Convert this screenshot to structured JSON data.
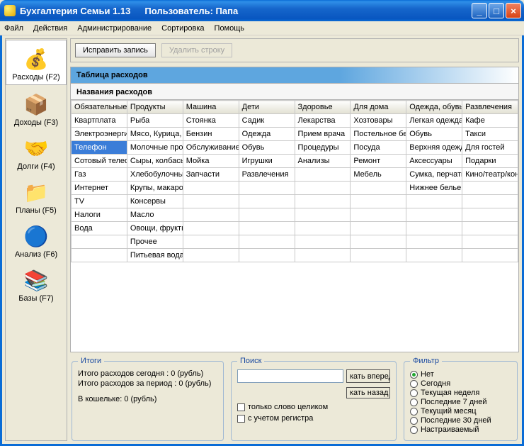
{
  "window": {
    "title": "Бухгалтерия Семьи 1.13",
    "user_label": "Пользователь: Папа"
  },
  "menu": [
    "Файл",
    "Действия",
    "Администрирование",
    "Сортировка",
    "Помощь"
  ],
  "sidebar": [
    {
      "label": "Расходы (F2)",
      "icon": "💰",
      "active": true
    },
    {
      "label": "Доходы (F3)",
      "icon": "📦",
      "active": false
    },
    {
      "label": "Долги (F4)",
      "icon": "🤝",
      "active": false
    },
    {
      "label": "Планы (F5)",
      "icon": "📁",
      "active": false
    },
    {
      "label": "Анализ (F6)",
      "icon": "🔵",
      "active": false
    },
    {
      "label": "Базы (F7)",
      "icon": "📚",
      "active": false
    }
  ],
  "toolbar": {
    "edit_label": "Исправить запись",
    "delete_label": "Удалить строку"
  },
  "table": {
    "title": "Таблица расходов",
    "subtitle": "Названия расходов",
    "headers": [
      "Обязательные",
      "Продукты",
      "Машина",
      "Дети",
      "Здоровье",
      "Для дома",
      "Одежда, обувь",
      "Развлечения"
    ],
    "rows": [
      [
        "Квартплата",
        "Рыба",
        "Стоянка",
        "Садик",
        "Лекарства",
        "Хозтовары",
        "Легкая одежда",
        "Кафе"
      ],
      [
        "Электроэнергия",
        "Мясо, Курица,",
        "Бензин",
        "Одежда",
        "Прием врача",
        "Постельное белье",
        "Обувь",
        "Такси"
      ],
      [
        "Телефон",
        "Молочные продукты",
        "Обслуживание",
        "Обувь",
        "Процедуры",
        "Посуда",
        "Верхняя одежда",
        "Для гостей"
      ],
      [
        "Сотовый телефон",
        "Сыры, колбасы",
        "Мойка",
        "Игрушки",
        "Анализы",
        "Ремонт",
        "Аксессуары",
        "Подарки"
      ],
      [
        "Газ",
        "Хлебобулочные",
        "Запчасти",
        "Развлечения",
        "",
        "Мебель",
        "Сумка, перчатки",
        "Кино/театр/концерт"
      ],
      [
        "Интернет",
        "Крупы, макароны",
        "",
        "",
        "",
        "",
        "Нижнее белье",
        ""
      ],
      [
        "TV",
        "Консервы",
        "",
        "",
        "",
        "",
        "",
        ""
      ],
      [
        "Налоги",
        "Масло",
        "",
        "",
        "",
        "",
        "",
        ""
      ],
      [
        "Вода",
        "Овощи, фрукты",
        "",
        "",
        "",
        "",
        "",
        ""
      ],
      [
        "",
        "Прочее",
        "",
        "",
        "",
        "",
        "",
        ""
      ],
      [
        "",
        "Питьевая вода",
        "",
        "",
        "",
        "",
        "",
        ""
      ]
    ],
    "selected": {
      "row": 2,
      "col": 0
    }
  },
  "totals": {
    "legend": "Итоги",
    "line1": "Итого расходов сегодня : 0 (рубль)",
    "line2": "Итого расходов за период : 0 (рубль)",
    "line3": "В кошельке: 0 (рубль)"
  },
  "search": {
    "legend": "Поиск",
    "value": "",
    "btn_fwd": "кать вперед",
    "btn_back": "кать назад",
    "whole_word": "только слово целиком",
    "case_sensitive": "с учетом регистра"
  },
  "filter": {
    "legend": "Фильтр",
    "options": [
      "Нет",
      "Сегодня",
      "Текущая неделя",
      "Последние 7 дней",
      "Текущий месяц",
      "Последние 30 дней",
      "Настраиваемый"
    ],
    "selected": 0
  }
}
